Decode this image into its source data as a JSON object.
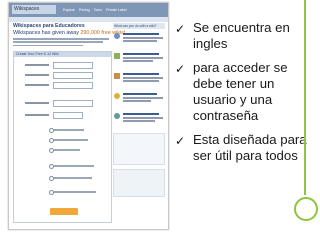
{
  "screenshot": {
    "logo_text": "Wikispaces",
    "nav": [
      "Explore",
      "Pricing",
      "Tours",
      "Private Label"
    ],
    "heading": "Wikispaces para Educadores",
    "subheading_main": "Wikispaces has given away ",
    "subheading_highlight": "290,000 free wikis!",
    "form_title": "Create Your Free K-12 Wiki",
    "sidebar_title": "What can you do with a wiki?"
  },
  "bullets": [
    {
      "text": "Se encuentra en ingles",
      "icon": "checkmark-icon"
    },
    {
      "text": "para acceder se debe tener un usuario y una contraseña",
      "icon": "checkmark-icon"
    },
    {
      "text": "Esta diseñada para ser útil para todos",
      "icon": "checkmark-icon"
    }
  ],
  "colors": {
    "accent": "#8cc63f",
    "header": "#7f97b7",
    "cta": "#f1a83a"
  }
}
